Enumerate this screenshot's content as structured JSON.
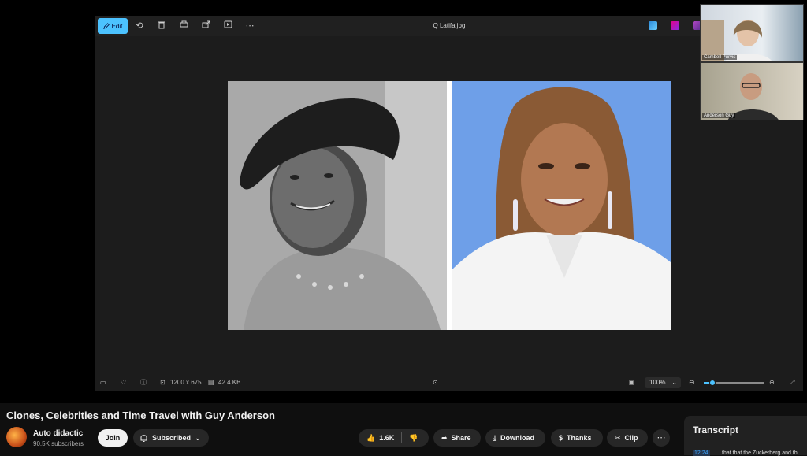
{
  "viewer": {
    "edit_label": "Edit",
    "file_title": "Q Latifa.jpg",
    "dimensions": "1200 x 675",
    "file_size": "42.4 KB",
    "zoom_level": "100%",
    "zoom_fraction": 0.15,
    "accent_color": "#4cc2ff"
  },
  "participants": [
    {
      "name": "Cambell Purvis"
    },
    {
      "name": "Anderson Guy"
    }
  ],
  "video": {
    "title": "Clones, Celebrities and Time Travel with Guy Anderson"
  },
  "channel": {
    "name": "Auto didactic",
    "subscribers": "90.5K subscribers",
    "join_label": "Join",
    "subscribed_label": "Subscribed"
  },
  "actions": {
    "likes": "1.6K",
    "share": "Share",
    "download": "Download",
    "thanks": "Thanks",
    "clip": "Clip"
  },
  "transcript": {
    "title": "Transcript",
    "time": "12:24",
    "text": "that that the Zuckerberg and th"
  }
}
